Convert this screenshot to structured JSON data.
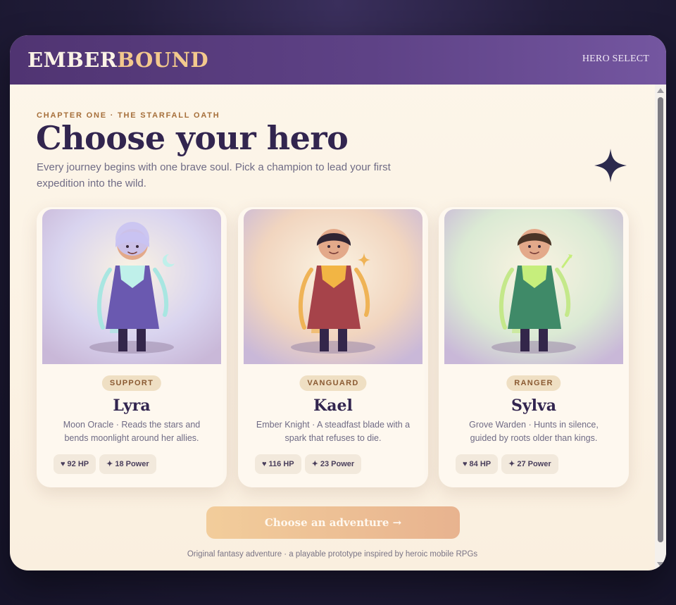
{
  "header": {
    "brand_part1": "EMBER",
    "brand_part2": "BOUND",
    "nav_label": "HERO SELECT"
  },
  "hero_section": {
    "kicker": "CHAPTER ONE · THE STARFALL OATH",
    "title": "Choose your hero",
    "intro": "Every journey begins with one brave soul. Pick a champion to lead your first expedition into the wild."
  },
  "heroes": [
    {
      "role": "SUPPORT",
      "name": "Lyra",
      "description": "Moon Oracle · Reads the stars and bends moonlight around her allies.",
      "hp_label": "92 HP",
      "power_label": "18 Power",
      "hp": 92,
      "power": 18,
      "emblem": "moon-icon",
      "colors": {
        "robe": "#6a59b0",
        "collar": "#bff0ea",
        "hair": "#c9c3f2",
        "wings": "#a8e6e1",
        "bg": "#d9d4ef"
      }
    },
    {
      "role": "VANGUARD",
      "name": "Kael",
      "description": "Ember Knight · A steadfast blade with a spark that refuses to die.",
      "hp_label": "116 HP",
      "power_label": "23 Power",
      "hp": 116,
      "power": 23,
      "emblem": "sparkle-icon",
      "colors": {
        "robe": "#a6434a",
        "collar": "#f2b544",
        "hair": "#2f2433",
        "wings": "#efb356",
        "bg": "#f1d5bf"
      }
    },
    {
      "role": "RANGER",
      "name": "Sylva",
      "description": "Grove Warden · Hunts in silence, guided by roots older than kings.",
      "hp_label": "84 HP",
      "power_label": "27 Power",
      "hp": 84,
      "power": 27,
      "emblem": "arrow-icon",
      "colors": {
        "robe": "#3f8a68",
        "collar": "#c6ee7c",
        "hair": "#4a3426",
        "wings": "#c4e88a",
        "bg": "#dbead4"
      }
    }
  ],
  "cta": {
    "label": "Choose an adventure →"
  },
  "footer": {
    "text": "Original fantasy adventure · a playable prototype inspired by heroic mobile RPGs"
  },
  "icons": {
    "hp": "heart-icon",
    "power": "sparkle-icon",
    "decor": "four-point-star-icon"
  }
}
